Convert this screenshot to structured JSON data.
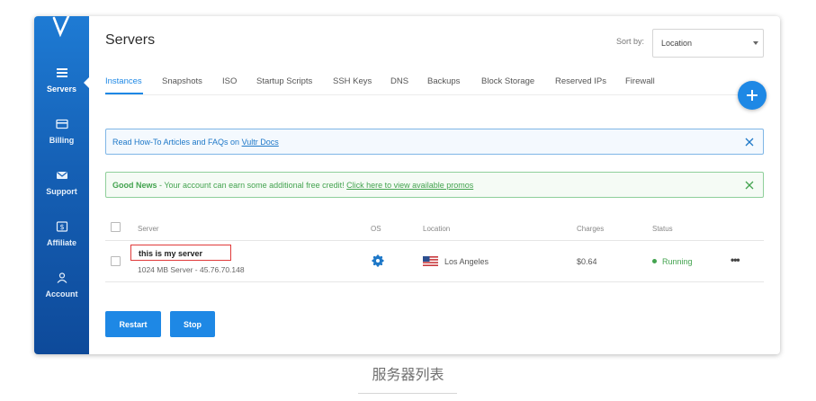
{
  "sidebar": {
    "logo_icon": "vultr-logo-icon",
    "items": [
      {
        "label": "Servers",
        "icon": "servers-icon",
        "active": true
      },
      {
        "label": "Billing",
        "icon": "credit-card-icon"
      },
      {
        "label": "Support",
        "icon": "envelope-icon"
      },
      {
        "label": "Affiliate",
        "icon": "dollar-icon"
      },
      {
        "label": "Account",
        "icon": "user-icon"
      }
    ]
  },
  "header": {
    "title": "Servers",
    "sort_label": "Sort by:",
    "sort_value": "Location"
  },
  "tabs": [
    "Instances",
    "Snapshots",
    "ISO",
    "Startup Scripts",
    "SSH Keys",
    "DNS",
    "Backups",
    "Block Storage",
    "Reserved IPs",
    "Firewall"
  ],
  "alerts": {
    "info": {
      "text": "Read How-To Articles and FAQs on ",
      "link": "Vultr Docs"
    },
    "good": {
      "title": "Good News",
      "text": " - Your account can earn some additional free credit! ",
      "link": "Click here to view available promos"
    }
  },
  "table": {
    "columns": [
      "Server",
      "OS",
      "Location",
      "Charges",
      "Status"
    ],
    "rows": [
      {
        "name": "this is my server",
        "detail": "1024 MB Server - 45.76.70.148",
        "os_icon": "freebsd-icon",
        "location": "Los Angeles",
        "charges": "$0.64",
        "status": "Running"
      }
    ]
  },
  "actions": {
    "restart": "Restart",
    "stop": "Stop"
  },
  "caption": "服务器列表",
  "colors": {
    "accent": "#1e88e5",
    "success": "#43a34f",
    "sidebar": "#1560b5"
  }
}
